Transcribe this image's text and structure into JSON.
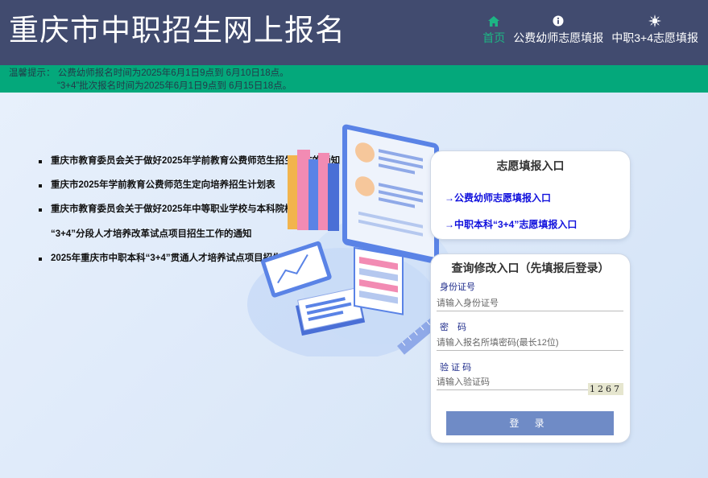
{
  "header": {
    "title": "重庆市中职招生网上报名",
    "nav": [
      {
        "icon": "home-icon",
        "label": "首页",
        "active": true
      },
      {
        "icon": "info-icon",
        "label": "公费幼师志愿填报",
        "active": false
      },
      {
        "icon": "sun-icon",
        "label": "中职3+4志愿填报",
        "active": false
      }
    ]
  },
  "notice": {
    "prefix": "温馨提示：",
    "line1": "公费幼师报名时间为2025年6月1日9点到 6月10日18点。",
    "line2": "“3+4”批次报名时间为2025年6月1日9点到 6月15日18点。"
  },
  "news": [
    {
      "text": "重庆市教育委员会关于做好2025年学前教育公费师范生招生工作的通知",
      "cont": ""
    },
    {
      "text": "重庆市2025年学前教育公费师范生定向培养招生计划表",
      "cont": ""
    },
    {
      "text": "重庆市教育委员会关于做好2025年中等职业学校与本科院校对口贯通",
      "cont": "“3+4”分段人才培养改革试点项目招生工作的通知"
    },
    {
      "text": "2025年重庆市中职本科“3+4”贯通人才培养试点项目招生计划",
      "cont": ""
    }
  ],
  "entry": {
    "title": "志愿填报入口",
    "links": [
      "→公费幼师志愿填报入口",
      "→中职本科“3+4”志愿填报入口"
    ]
  },
  "query": {
    "title": "查询修改入口（先填报后登录）",
    "id_label": "身份证号",
    "id_placeholder": "请输入身份证号",
    "pwd_label": "密　码",
    "pwd_placeholder": "请输入报名所填密码(最长12位)",
    "code_label": "验 证 码",
    "code_placeholder": "请输入验证码",
    "captcha": "1267",
    "login": "登 录"
  },
  "colors": {
    "header_bg": "#414b6f",
    "notice_bg": "#04a87b",
    "active_nav": "#1db584",
    "link": "#1111dd",
    "login_bg": "#6f8bc6"
  }
}
